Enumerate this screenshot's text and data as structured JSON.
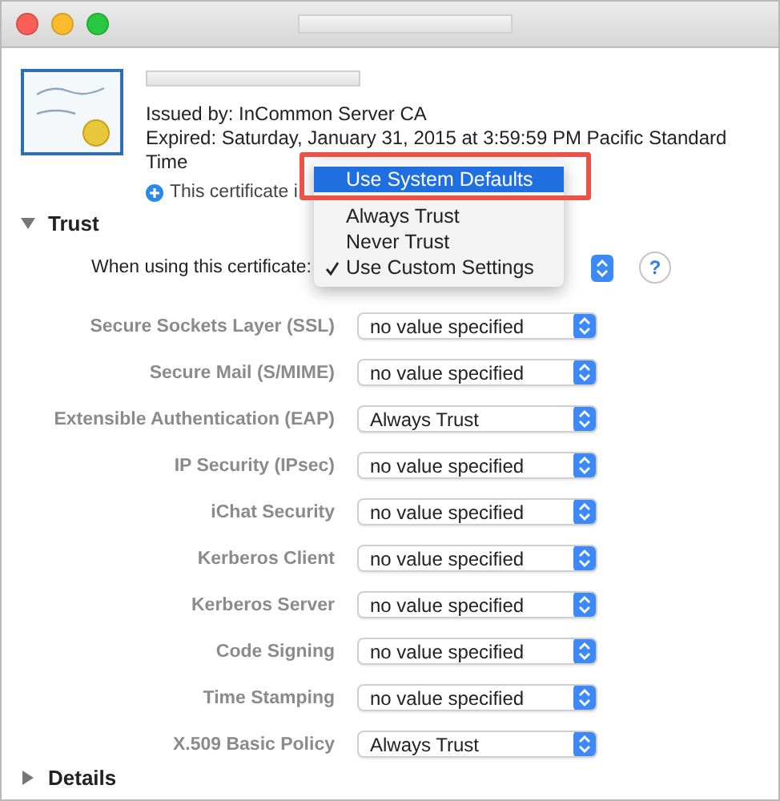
{
  "certificate": {
    "issuer": "Issued by: InCommon Server CA",
    "expiry": "Expired: Saturday, January 31, 2015 at 3:59:59 PM Pacific Standard Time",
    "note": "This certificate i"
  },
  "trust": {
    "label": "Trust",
    "expanded": true,
    "when_label": "When using this certificate:",
    "help_label": "?",
    "menu_highlighted": true,
    "menu": [
      {
        "kind": "item",
        "label": "Use System Defaults",
        "selected": true,
        "checked": false
      },
      {
        "kind": "separator"
      },
      {
        "kind": "item",
        "label": "Always Trust",
        "selected": false,
        "checked": false
      },
      {
        "kind": "item",
        "label": "Never Trust",
        "selected": false,
        "checked": false
      },
      {
        "kind": "item",
        "label": "Use Custom Settings",
        "selected": false,
        "checked": true
      }
    ],
    "policies": [
      {
        "name": "Secure Sockets Layer (SSL)",
        "value": "no value specified"
      },
      {
        "name": "Secure Mail (S/MIME)",
        "value": "no value specified"
      },
      {
        "name": "Extensible Authentication (EAP)",
        "value": "Always Trust"
      },
      {
        "name": "IP Security (IPsec)",
        "value": "no value specified"
      },
      {
        "name": "iChat Security",
        "value": "no value specified"
      },
      {
        "name": "Kerberos Client",
        "value": "no value specified"
      },
      {
        "name": "Kerberos Server",
        "value": "no value specified"
      },
      {
        "name": "Code Signing",
        "value": "no value specified"
      },
      {
        "name": "Time Stamping",
        "value": "no value specified"
      },
      {
        "name": "X.509 Basic Policy",
        "value": "Always Trust"
      }
    ]
  },
  "details": {
    "label": "Details",
    "expanded": false
  }
}
